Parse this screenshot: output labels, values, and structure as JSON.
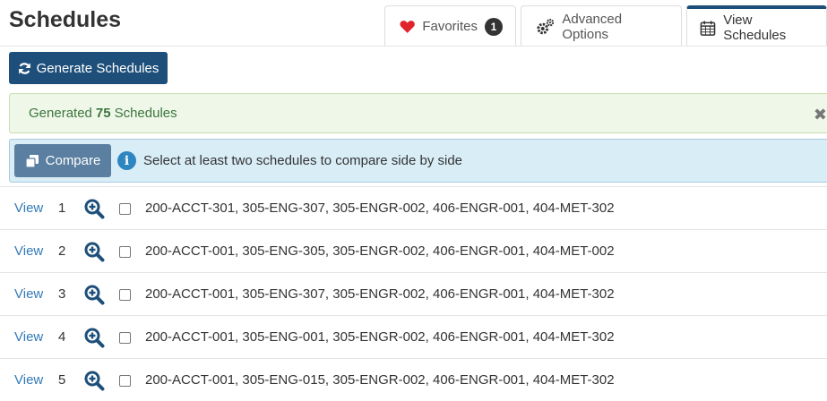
{
  "page": {
    "title": "Schedules"
  },
  "tabs": {
    "favorites": {
      "label": "Favorites",
      "count": "1",
      "icon": "heart-icon"
    },
    "advanced": {
      "label": "Advanced Options",
      "icon": "cogs-icon"
    },
    "view": {
      "label": "View Schedules",
      "icon": "calendar-icon",
      "active": true
    }
  },
  "toolbar": {
    "generate_label": "Generate Schedules"
  },
  "alerts": {
    "success_prefix": "Generated",
    "success_count": "75",
    "success_suffix": "Schedules",
    "close_glyph": "✖",
    "compare_label": "Compare",
    "info_glyph": "i",
    "info_text": "Select at least two schedules to compare side by side"
  },
  "schedules": [
    {
      "link": "View",
      "num": "1",
      "courses": "200-ACCT-301, 305-ENG-307, 305-ENGR-002, 406-ENGR-001, 404-MET-302"
    },
    {
      "link": "View",
      "num": "2",
      "courses": "200-ACCT-001, 305-ENG-305, 305-ENGR-002, 406-ENGR-001, 404-MET-002"
    },
    {
      "link": "View",
      "num": "3",
      "courses": "200-ACCT-001, 305-ENG-307, 305-ENGR-002, 406-ENGR-001, 404-MET-302"
    },
    {
      "link": "View",
      "num": "4",
      "courses": "200-ACCT-001, 305-ENG-001, 305-ENGR-002, 406-ENGR-001, 404-MET-302"
    },
    {
      "link": "View",
      "num": "5",
      "courses": "200-ACCT-001, 305-ENG-015, 305-ENGR-002, 406-ENGR-001, 404-MET-302"
    }
  ],
  "colors": {
    "primary": "#1d4f7a",
    "link": "#337ab7",
    "heart": "#e0242b",
    "success_bg": "#eff7e9",
    "info_bg": "#d9edf7"
  }
}
